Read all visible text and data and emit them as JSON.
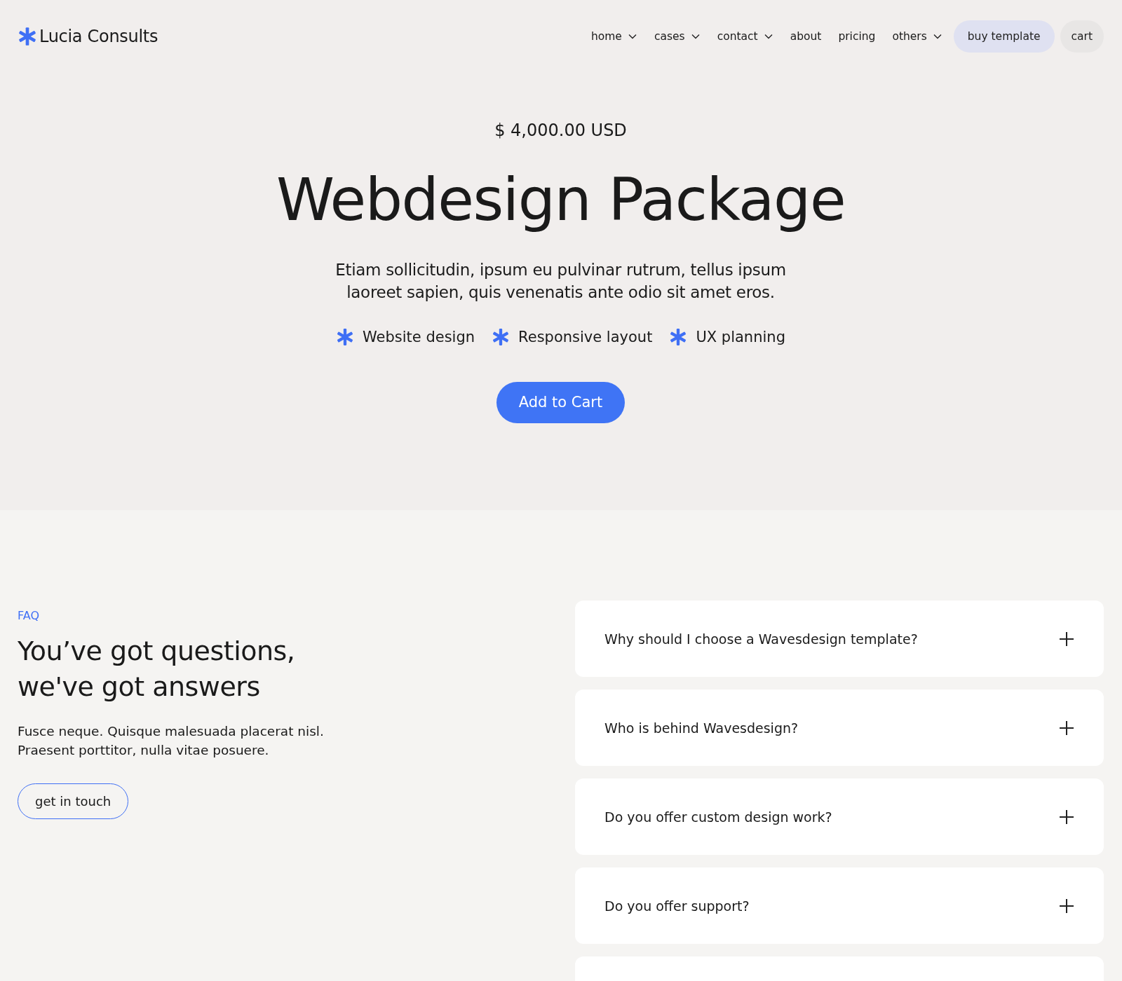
{
  "brand": {
    "name": "Lucia Consults"
  },
  "nav": [
    {
      "label": "home",
      "dropdown": true
    },
    {
      "label": "cases",
      "dropdown": true
    },
    {
      "label": "contact",
      "dropdown": true
    },
    {
      "label": "about",
      "dropdown": false
    },
    {
      "label": "pricing",
      "dropdown": false
    },
    {
      "label": "others",
      "dropdown": true
    }
  ],
  "header_buttons": [
    {
      "label": "buy template",
      "kind": "primary"
    },
    {
      "label": "cart",
      "kind": "plain"
    }
  ],
  "product": {
    "price": "$ 4,000.00 USD",
    "title": "Webdesign Package",
    "description": "Etiam sollicitudin, ipsum eu pulvinar rutrum, tellus ipsum laoreet sapien, quis venenatis ante odio sit amet eros.",
    "features": [
      "Website design",
      "Responsive layout",
      "UX planning"
    ],
    "button": "Add to Cart"
  },
  "faq": {
    "eyebrow": "FAQ",
    "heading": "You’ve got questions, we've got answers",
    "text": "Fusce neque. Quisque malesuada placerat nisl. Praesent porttitor, nulla vitae posuere.",
    "button": "get in touch",
    "items": [
      {
        "question": "Why should I choose a Wavesdesign template?",
        "expanded": false
      },
      {
        "question": "Who is behind Wavesdesign?",
        "expanded": false
      },
      {
        "question": "Do you offer custom design work?",
        "expanded": false
      },
      {
        "question": "Do you offer support?",
        "expanded": false
      }
    ]
  }
}
